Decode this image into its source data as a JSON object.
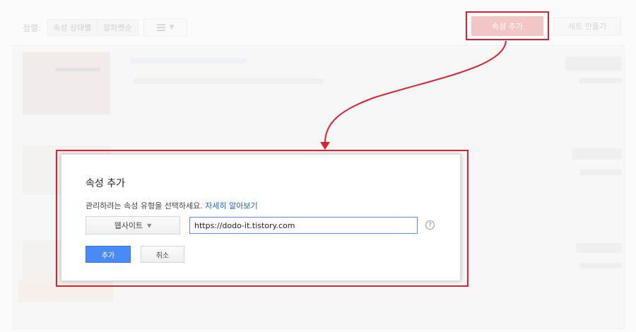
{
  "toolbar": {
    "sort_label": "정렬:",
    "sort_options": [
      "속성 상태별",
      "알파벳순"
    ],
    "add_property_label": "속성 추가",
    "create_set_label": "세트 만들기"
  },
  "dialog": {
    "title": "속성 추가",
    "description": "관리하려는 속성 유형을 선택하세요.",
    "learn_more_link": "자세히 알아보기",
    "type_select_value": "웹사이트",
    "url_value": "https://dodo-it.tistory.com",
    "help_icon": "?",
    "add_button": "추가",
    "cancel_button": "취소"
  },
  "colors": {
    "highlight": "#d9232e",
    "primary": "#4a8af4",
    "link": "#1a5fc9"
  }
}
